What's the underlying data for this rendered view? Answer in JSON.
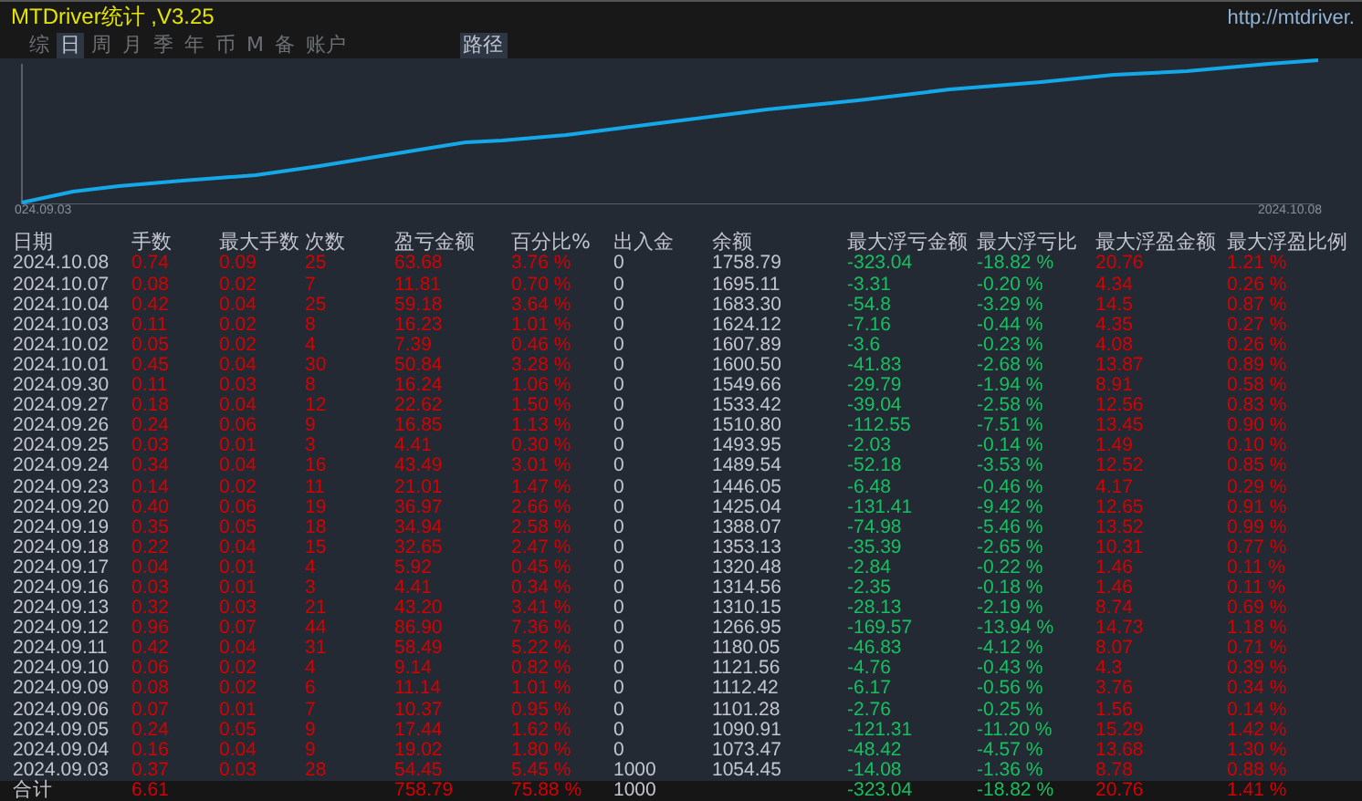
{
  "window": {
    "title": "MTDriver统计 ,V3.25",
    "url": "http://mtdriver."
  },
  "tabs": [
    {
      "label": "综",
      "selected": false
    },
    {
      "label": "日",
      "selected": true
    },
    {
      "label": "周",
      "selected": false
    },
    {
      "label": "月",
      "selected": false
    },
    {
      "label": "季",
      "selected": false
    },
    {
      "label": "年",
      "selected": false
    },
    {
      "label": "币",
      "selected": false
    },
    {
      "label": "M",
      "selected": false
    },
    {
      "label": "备",
      "selected": false
    },
    {
      "label": "账户",
      "selected": false
    }
  ],
  "path_button": "路径",
  "chart": {
    "start_label": "024.09.03",
    "end_label": "2024.10.08"
  },
  "table": {
    "columns": [
      "日期",
      "手数",
      "最大手数",
      "次数",
      "盈亏金额",
      "百分比%",
      "出入金",
      "余额",
      "最大浮亏金额",
      "最大浮亏比",
      "最大浮盈金额",
      "最大浮盈比例"
    ],
    "rows": [
      [
        "2024.10.08",
        "0.74",
        "0.09",
        "25",
        "63.68",
        "3.76 %",
        "0",
        "1758.79",
        "-323.04",
        "-18.82 %",
        "20.76",
        "1.21 %"
      ],
      [
        "2024.10.07",
        "0.08",
        "0.02",
        "7",
        "11.81",
        "0.70 %",
        "0",
        "1695.11",
        "-3.31",
        "-0.20 %",
        "4.34",
        "0.26 %"
      ],
      [
        "2024.10.04",
        "0.42",
        "0.04",
        "25",
        "59.18",
        "3.64 %",
        "0",
        "1683.30",
        "-54.8",
        "-3.29 %",
        "14.5",
        "0.87 %"
      ],
      [
        "2024.10.03",
        "0.11",
        "0.02",
        "8",
        "16.23",
        "1.01 %",
        "0",
        "1624.12",
        "-7.16",
        "-0.44 %",
        "4.35",
        "0.27 %"
      ],
      [
        "2024.10.02",
        "0.05",
        "0.02",
        "4",
        "7.39",
        "0.46 %",
        "0",
        "1607.89",
        "-3.6",
        "-0.23 %",
        "4.08",
        "0.26 %"
      ],
      [
        "2024.10.01",
        "0.45",
        "0.04",
        "30",
        "50.84",
        "3.28 %",
        "0",
        "1600.50",
        "-41.83",
        "-2.68 %",
        "13.87",
        "0.89 %"
      ],
      [
        "2024.09.30",
        "0.11",
        "0.03",
        "8",
        "16.24",
        "1.06 %",
        "0",
        "1549.66",
        "-29.79",
        "-1.94 %",
        "8.91",
        "0.58 %"
      ],
      [
        "2024.09.27",
        "0.18",
        "0.04",
        "12",
        "22.62",
        "1.50 %",
        "0",
        "1533.42",
        "-39.04",
        "-2.58 %",
        "12.56",
        "0.83 %"
      ],
      [
        "2024.09.26",
        "0.24",
        "0.06",
        "9",
        "16.85",
        "1.13 %",
        "0",
        "1510.80",
        "-112.55",
        "-7.51 %",
        "13.45",
        "0.90 %"
      ],
      [
        "2024.09.25",
        "0.03",
        "0.01",
        "3",
        "4.41",
        "0.30 %",
        "0",
        "1493.95",
        "-2.03",
        "-0.14 %",
        "1.49",
        "0.10 %"
      ],
      [
        "2024.09.24",
        "0.34",
        "0.04",
        "16",
        "43.49",
        "3.01 %",
        "0",
        "1489.54",
        "-52.18",
        "-3.53 %",
        "12.52",
        "0.85 %"
      ],
      [
        "2024.09.23",
        "0.14",
        "0.02",
        "11",
        "21.01",
        "1.47 %",
        "0",
        "1446.05",
        "-6.48",
        "-0.46 %",
        "4.17",
        "0.29 %"
      ],
      [
        "2024.09.20",
        "0.40",
        "0.06",
        "19",
        "36.97",
        "2.66 %",
        "0",
        "1425.04",
        "-131.41",
        "-9.42 %",
        "12.65",
        "0.91 %"
      ],
      [
        "2024.09.19",
        "0.35",
        "0.05",
        "18",
        "34.94",
        "2.58 %",
        "0",
        "1388.07",
        "-74.98",
        "-5.46 %",
        "13.52",
        "0.99 %"
      ],
      [
        "2024.09.18",
        "0.22",
        "0.04",
        "15",
        "32.65",
        "2.47 %",
        "0",
        "1353.13",
        "-35.39",
        "-2.65 %",
        "10.31",
        "0.77 %"
      ],
      [
        "2024.09.17",
        "0.04",
        "0.01",
        "4",
        "5.92",
        "0.45 %",
        "0",
        "1320.48",
        "-2.84",
        "-0.22 %",
        "1.46",
        "0.11 %"
      ],
      [
        "2024.09.16",
        "0.03",
        "0.01",
        "3",
        "4.41",
        "0.34 %",
        "0",
        "1314.56",
        "-2.35",
        "-0.18 %",
        "1.46",
        "0.11 %"
      ],
      [
        "2024.09.13",
        "0.32",
        "0.03",
        "21",
        "43.20",
        "3.41 %",
        "0",
        "1310.15",
        "-28.13",
        "-2.19 %",
        "8.74",
        "0.69 %"
      ],
      [
        "2024.09.12",
        "0.96",
        "0.07",
        "44",
        "86.90",
        "7.36 %",
        "0",
        "1266.95",
        "-169.57",
        "-13.94 %",
        "14.73",
        "1.18 %"
      ],
      [
        "2024.09.11",
        "0.42",
        "0.04",
        "31",
        "58.49",
        "5.22 %",
        "0",
        "1180.05",
        "-46.83",
        "-4.12 %",
        "8.07",
        "0.71 %"
      ],
      [
        "2024.09.10",
        "0.06",
        "0.02",
        "4",
        "9.14",
        "0.82 %",
        "0",
        "1121.56",
        "-4.76",
        "-0.43 %",
        "4.3",
        "0.39 %"
      ],
      [
        "2024.09.09",
        "0.08",
        "0.02",
        "6",
        "11.14",
        "1.01 %",
        "0",
        "1112.42",
        "-6.17",
        "-0.56 %",
        "3.76",
        "0.34 %"
      ],
      [
        "2024.09.06",
        "0.07",
        "0.01",
        "7",
        "10.37",
        "0.95 %",
        "0",
        "1101.28",
        "-2.76",
        "-0.25 %",
        "1.56",
        "0.14 %"
      ],
      [
        "2024.09.05",
        "0.24",
        "0.05",
        "9",
        "17.44",
        "1.62 %",
        "0",
        "1090.91",
        "-121.31",
        "-11.20 %",
        "15.29",
        "1.42 %"
      ],
      [
        "2024.09.04",
        "0.16",
        "0.04",
        "9",
        "19.02",
        "1.80 %",
        "0",
        "1073.47",
        "-48.42",
        "-4.57 %",
        "13.68",
        "1.30 %"
      ],
      [
        "2024.09.03",
        "0.37",
        "0.03",
        "28",
        "54.45",
        "5.45 %",
        "1000",
        "1054.45",
        "-14.08",
        "-1.36 %",
        "8.78",
        "0.88 %"
      ]
    ],
    "total": {
      "label": "合计",
      "lots": "6.61",
      "pnl": "758.79",
      "pct": "75.88 %",
      "flow": "1000",
      "max_float_loss": "-323.04",
      "max_float_loss_pct": "-18.82 %",
      "max_float_profit": "20.76",
      "max_float_profit_pct": "1.41 %"
    }
  }
}
